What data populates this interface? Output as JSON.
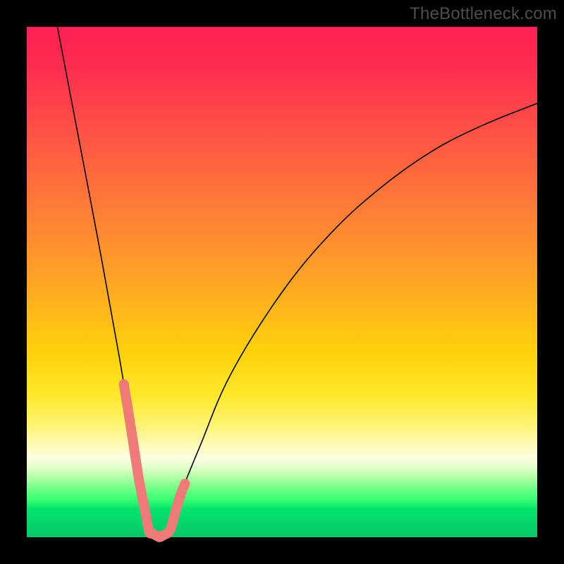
{
  "watermark": "TheBottleneck.com",
  "colors": {
    "highlight": "#ef7a78",
    "curve": "#000000",
    "frame": "#000000"
  },
  "chart_data": {
    "type": "line",
    "title": "",
    "xlabel": "",
    "ylabel": "",
    "xlim": [
      0,
      100
    ],
    "ylim": [
      0,
      100
    ],
    "grid": false,
    "legend": false,
    "notes": "V-shaped bottleneck curve. Background hue encodes bottleneck severity: green≈0 near bottom, red≈100 near top. Curve minimum (~0) occurs around x≈25; thick salmon segments highlight the near-zero region on both sides of the minimum.",
    "series": [
      {
        "name": "bottleneck-curve",
        "x": [
          6,
          10,
          14,
          18,
          20,
          22,
          24,
          26,
          28,
          30,
          34,
          40,
          50,
          60,
          70,
          80,
          90,
          100
        ],
        "values": [
          100,
          79,
          58,
          36,
          24,
          11,
          1,
          0,
          1,
          8,
          18,
          32,
          48,
          60,
          69,
          76,
          81,
          85
        ]
      }
    ],
    "highlight_ranges_x": [
      [
        19,
        23.5
      ],
      [
        26.5,
        31
      ]
    ],
    "floor_segment_x": [
      23.5,
      26.5
    ]
  }
}
